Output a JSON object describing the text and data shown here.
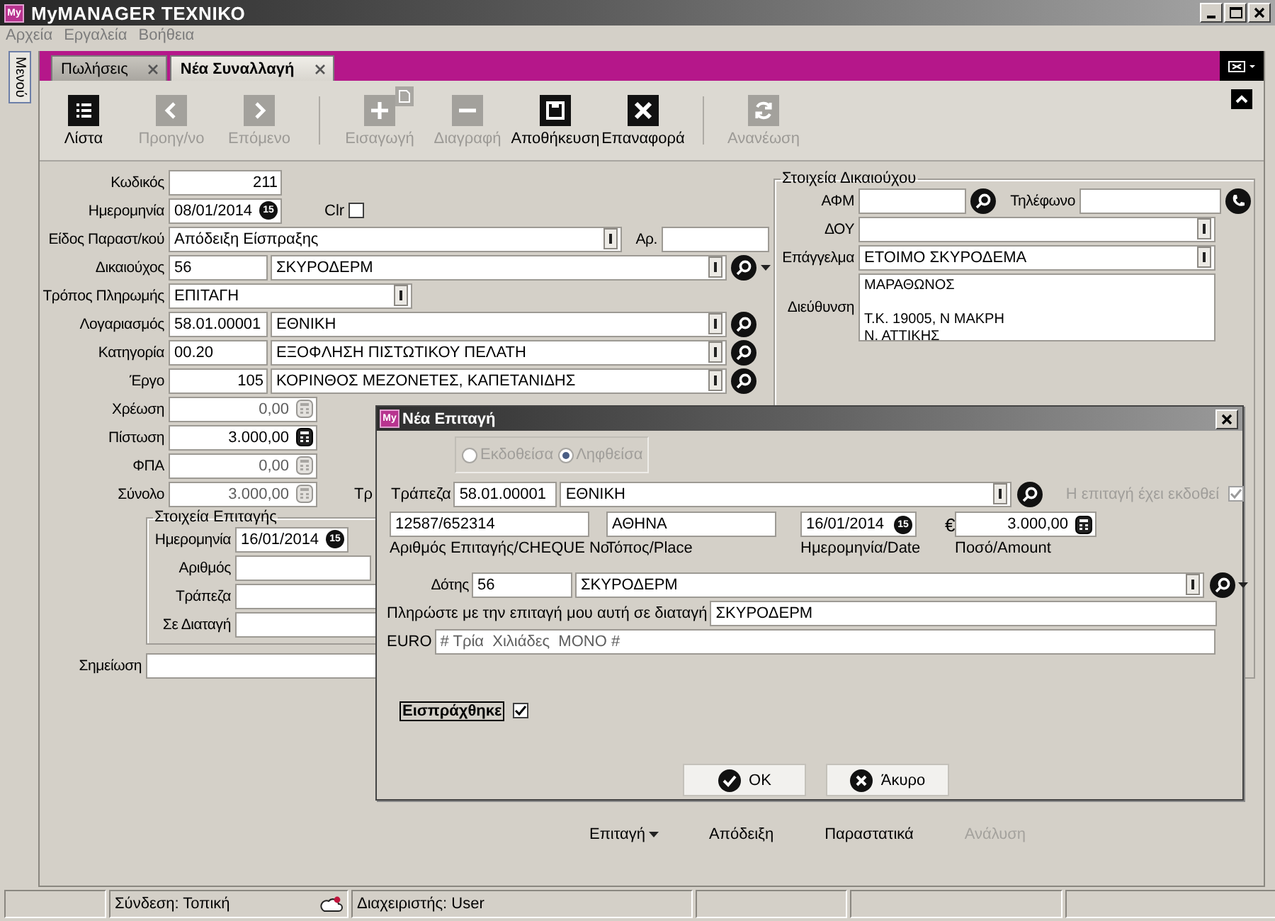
{
  "window": {
    "logo": "My",
    "title": "MyMANAGER ΤΕΧΝΙΚΟ"
  },
  "menu": [
    "Αρχεία",
    "Εργαλεία",
    "Βοήθεια"
  ],
  "side_tab": "Μενού",
  "tabs": [
    {
      "label": "Πωλήσεις",
      "selected": false
    },
    {
      "label": "Νέα Συναλλαγή",
      "selected": true
    }
  ],
  "toolbar": [
    {
      "label": "Λίστα",
      "kind": "list",
      "disabled": false,
      "separator_before": false
    },
    {
      "label": "Προηγ/νο",
      "kind": "prev",
      "disabled": true,
      "separator_before": false
    },
    {
      "label": "Επόμενο",
      "kind": "next",
      "disabled": true,
      "separator_before": false
    },
    {
      "label": "Εισαγωγή",
      "kind": "add",
      "disabled": true,
      "separator_before": true
    },
    {
      "label": "Διαγραφή",
      "kind": "remove",
      "disabled": true,
      "separator_before": false
    },
    {
      "label": "Αποθήκευση",
      "kind": "save",
      "disabled": false,
      "separator_before": false
    },
    {
      "label": "Επαναφορά",
      "kind": "close",
      "disabled": false,
      "separator_before": false
    },
    {
      "label": "Ανανέωση",
      "kind": "refresh",
      "disabled": true,
      "separator_before": true
    }
  ],
  "form": {
    "code": {
      "label": "Κωδικός",
      "value": "211"
    },
    "date": {
      "label": "Ημερομηνία",
      "value": "08/01/2014",
      "day": "15"
    },
    "clr": {
      "label": "Clr",
      "checked": false
    },
    "doc_type": {
      "label": "Είδος Παραστ/κού",
      "value": "Απόδειξη Είσπραξης"
    },
    "doc_no": {
      "label": "Αρ."
    },
    "lookups": [
      {
        "kind": "lookup",
        "label": "Δικαιούχος",
        "code": "56",
        "name": "ΣΚΥΡΟΔΕΡΜ",
        "menu": true
      },
      {
        "kind": "combo",
        "label": "Τρόπος Πληρωμής",
        "value": "ΕΠΙΤΑΓΗ"
      },
      {
        "kind": "lookup",
        "label": "Λογαριασμός",
        "code": "58.01.00001",
        "name": "ΕΘΝΙΚΗ",
        "menu": false
      },
      {
        "kind": "lookup",
        "label": "Κατηγορία",
        "code": "00.20",
        "name": "ΕΞΟΦΛΗΣΗ ΠΙΣΤΩΤΙΚΟΥ ΠΕΛΑΤΗ",
        "menu": false
      },
      {
        "kind": "lookup_number",
        "label": "Έργο",
        "code": "105",
        "name": "ΚΟΡΙΝΘΟΣ ΜΕΖΟΝΕΤΕΣ, ΚΑΠΕΤΑΝΙΔΗΣ",
        "menu": false
      }
    ],
    "amounts": [
      {
        "label": "Χρέωση",
        "value": "0,00",
        "disabled": true
      },
      {
        "label": "Πίστωση",
        "value": "3.000,00",
        "disabled": false
      },
      {
        "label": "ΦΠΑ",
        "value": "0,00",
        "disabled": true
      },
      {
        "label": "Σύνολο",
        "value": "3.000,00",
        "disabled": true
      }
    ],
    "partial_label": "Τρ",
    "cheque": {
      "title": "Στοιχεία Επιταγής",
      "date": {
        "label": "Ημερομηνία",
        "value": "16/01/2014",
        "day": "15"
      },
      "fields": [
        {
          "label": "Αριθμός"
        },
        {
          "label": "Τράπεζα"
        },
        {
          "label": "Σε Διαταγή"
        }
      ]
    },
    "note": {
      "label": "Σημείωση"
    }
  },
  "beneficiary": {
    "title": "Στοιχεία Δικαιούχου",
    "afm": {
      "label": "ΑΦΜ"
    },
    "phone": {
      "label": "Τηλέφωνο"
    },
    "doy": {
      "label": "ΔΟΥ"
    },
    "profession": {
      "label": "Επάγγελμα",
      "value": "ΕΤΟΙΜΟ ΣΚΥΡΟΔΕΜΑ"
    },
    "address": {
      "label": "Διεύθυνση",
      "value": "ΜΑΡΑΘΩΝΟΣ\n\nΤ.Κ. 19005, Ν ΜΑΚΡΗ\nΝ. ΑΤΤΙΚΗΣ"
    }
  },
  "actions": [
    {
      "label": "Επιταγή",
      "menu": true,
      "disabled": false
    },
    {
      "label": "Απόδειξη",
      "menu": false,
      "disabled": false
    },
    {
      "label": "Παραστατικά",
      "menu": false,
      "disabled": false
    },
    {
      "label": "Ανάλυση",
      "menu": false,
      "disabled": true
    }
  ],
  "status_bar": [
    {
      "text": "Σύνδεση: Τοπική",
      "kind": "connection"
    },
    {
      "text": "Διαχειριστής: User",
      "kind": "user"
    }
  ],
  "dialog": {
    "logo": "My",
    "title": "Νέα Επιταγή",
    "direction": [
      {
        "label": "Εκδοθείσα",
        "selected": false
      },
      {
        "label": "Ληφθείσα",
        "selected": true
      }
    ],
    "bank": {
      "label": "Τράπεζα",
      "code": "58.01.00001",
      "name": "ΕΘΝΙΚΗ"
    },
    "issued": {
      "label": "Η επιταγή έχει εκδοθεί",
      "checked": true
    },
    "details": [
      {
        "kind": "text",
        "value": "12587/652314",
        "caption": "Αριθμός Επιταγής/CHEQUE No"
      },
      {
        "kind": "text",
        "value": "ΑΘΗΝΑ",
        "caption": "Τόπος/Place"
      },
      {
        "kind": "date",
        "value": "16/01/2014",
        "day": "15",
        "caption": "Ημερομηνία/Date"
      },
      {
        "kind": "amount",
        "currency": "€",
        "value": "3.000,00",
        "caption": "Ποσό/Amount"
      }
    ],
    "drawer": {
      "label": "Δότης",
      "code": "56",
      "name": "ΣΚΥΡΟΔΕΡΜ"
    },
    "payee": {
      "label": "Πληρώστε με την επιταγή μου αυτή σε διαταγή",
      "value": "ΣΚΥΡΟΔΕΡΜ"
    },
    "words": {
      "label": "EURO",
      "value": "# Τρία  Χιλιάδες  ΜΟΝΟ #"
    },
    "collected": {
      "label": "Εισπράχθηκε",
      "checked": true
    },
    "buttons": [
      {
        "kind": "ok",
        "label": "OK"
      },
      {
        "kind": "cancel",
        "label": "Άκυρο"
      }
    ]
  }
}
